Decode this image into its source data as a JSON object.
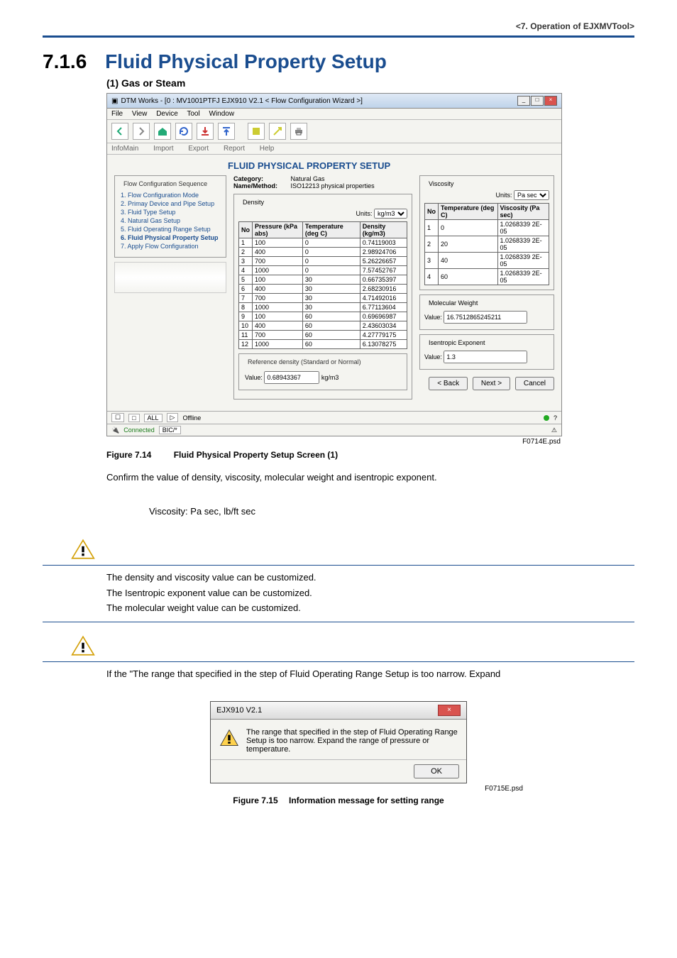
{
  "header": {
    "breadcrumb": "<7.  Operation of EJXMVTool>"
  },
  "section": {
    "number": "7.1.6",
    "title": "Fluid Physical Property Setup"
  },
  "sub1": {
    "label": "(1)   Gas or Steam"
  },
  "shot": {
    "titlebar": "DTM Works - [0 : MV1001PTFJ EJX910 V2.1 < Flow Configuration  Wizard >]",
    "menus": [
      "File",
      "View",
      "Device",
      "Tool",
      "Window"
    ],
    "tabs": [
      "InfoMain",
      "Import",
      "Export",
      "Report",
      "Help"
    ],
    "panelTitle": "FLUID PHYSICAL PROPERTY SETUP",
    "seqLegend": "Flow Configuration Sequence",
    "steps": [
      "1. Flow Configuration Mode",
      "2. Primay Device and Pipe Setup",
      "3. Fluid Type Setup",
      "4. Natural Gas Setup",
      "5. Fluid Operating Range Setup",
      "6. Fluid Physical Property Setup",
      "7. Apply Flow Configuration"
    ],
    "categoryLbl": "Category:",
    "categoryVal": "Natural Gas",
    "methodLbl": "Name/Method:",
    "methodVal": "ISO12213 physical properties",
    "densityLegend": "Density",
    "unitsLbl": "Units:",
    "densityUnits": "kg/m3",
    "densCols": [
      "No",
      "Pressure (kPa abs)",
      "Temperature (deg C)",
      "Density (kg/m3)"
    ],
    "densRows": [
      [
        "1",
        "100",
        "0",
        "0.74119003"
      ],
      [
        "2",
        "400",
        "0",
        "2.98924706"
      ],
      [
        "3",
        "700",
        "0",
        "5.26226657"
      ],
      [
        "4",
        "1000",
        "0",
        "7.57452767"
      ],
      [
        "5",
        "100",
        "30",
        "0.66735397"
      ],
      [
        "6",
        "400",
        "30",
        "2.68230916"
      ],
      [
        "7",
        "700",
        "30",
        "4.71492016"
      ],
      [
        "8",
        "1000",
        "30",
        "6.77113604"
      ],
      [
        "9",
        "100",
        "60",
        "0.69696987"
      ],
      [
        "10",
        "400",
        "60",
        "2.43603034"
      ],
      [
        "11",
        "700",
        "60",
        "4.27779175"
      ],
      [
        "12",
        "1000",
        "60",
        "6.13078275"
      ]
    ],
    "refLegend": "Reference density (Standard or Normal)",
    "refLbl": "Value:",
    "refVal": "0.68943367",
    "refUnit": "kg/m3",
    "viscLegend": "Viscosity",
    "viscUnits": "Pa sec",
    "viscCols": [
      "No",
      "Temperature (deg C)",
      "Viscosity (Pa  sec)"
    ],
    "viscRows": [
      [
        "1",
        "0",
        "1.0268339 2E-05"
      ],
      [
        "2",
        "20",
        "1.0268339 2E-05"
      ],
      [
        "3",
        "40",
        "1.0268339 2E-05"
      ],
      [
        "4",
        "60",
        "1.0268339 2E-05"
      ]
    ],
    "molLegend": "Molecular Weight",
    "molVal": "16.7512865245211",
    "isoLegend": "Isentropic Exponent",
    "isoVal": "1.3",
    "back": "< Back",
    "next": "Next >",
    "cancel": "Cancel",
    "offlineTag": "Offline",
    "conn": "Connected",
    "connSeg": "BIC/*",
    "psd": "F0714E.psd"
  },
  "fig1": {
    "label": "Figure 7.14",
    "caption": "Fluid Physical Property Setup Screen (1)"
  },
  "para1": "Confirm the value of density, viscosity, molecular weight and isentropic exponent.",
  "para2": "Viscosity: Pa sec, lb/ft sec",
  "note1": {
    "l1": "The density and viscosity value can be customized.",
    "l2": "The Isentropic exponent value can be customized.",
    "l3": "The molecular weight value can be customized."
  },
  "note2": "If the \"The range that specified in the step of Fluid Operating Range Setup is too narrow. Expand",
  "dialog": {
    "title": "EJX910 V2.1",
    "msg": "The range that specified in the step of Fluid Operating Range Setup is too narrow. Expand the range of pressure or temperature.",
    "ok": "OK",
    "psd": "F0715E.psd"
  },
  "fig2": {
    "label": "Figure 7.15",
    "caption": "Information message for setting range"
  }
}
